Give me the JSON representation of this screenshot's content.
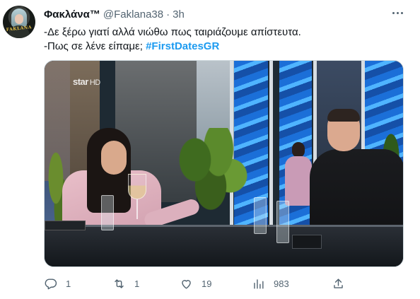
{
  "tweet": {
    "author": {
      "name": "Φακλάνα™",
      "handle": "@Faklana38",
      "avatar_text": "FAKLANA"
    },
    "separator": "·",
    "time": "3h",
    "text_lines": [
      "-Δε ξέρω γιατί αλλά νιώθω πως ταιριάζουμε απίστευτα.",
      "-Πως σε λένε είπαμε;"
    ],
    "hashtag": "#FirstDatesGR",
    "media": {
      "channel_watermark": "star",
      "channel_watermark_suffix": "HD"
    },
    "actions": {
      "reply_count": "1",
      "retweet_count": "1",
      "like_count": "19",
      "views_count": "983"
    }
  },
  "colors": {
    "accent": "#1d9bf0",
    "secondary_text": "#536471",
    "primary_text": "#0f1419"
  }
}
